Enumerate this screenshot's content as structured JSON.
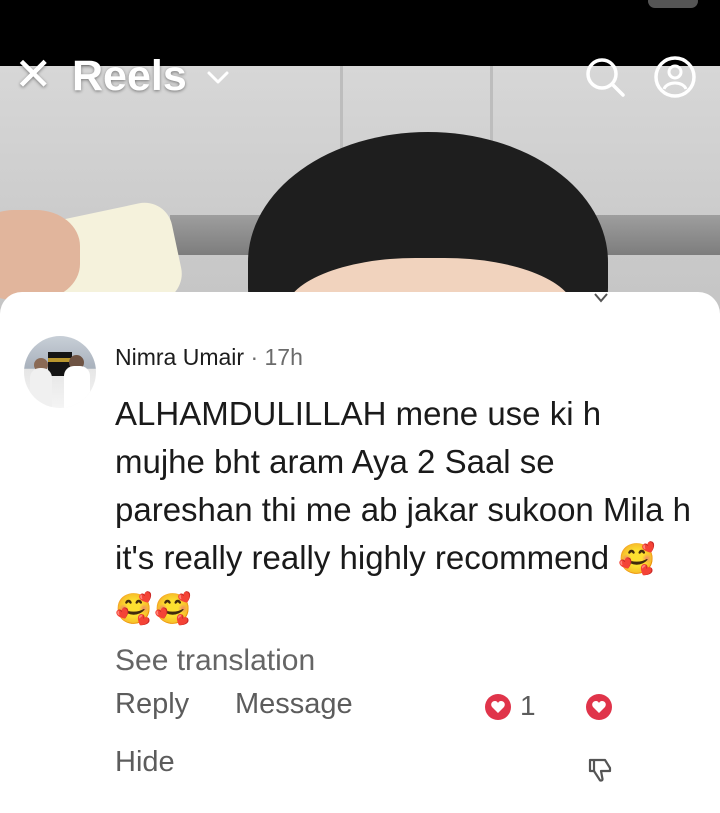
{
  "header": {
    "close_icon": "✕",
    "title": "Reels"
  },
  "comment": {
    "author": "Nimra Umair",
    "separator": "·",
    "time": "17h",
    "text": "ALHAMDULILLAH mene use ki h mujhe bht aram Aya 2 Saal se pareshan thi me ab jakar sukoon Mila h it's really really highly recommend",
    "emojis": "🥰🥰🥰",
    "see_translation": "See translation",
    "actions": {
      "reply": "Reply",
      "message": "Message",
      "hide": "Hide"
    },
    "like_count": "1"
  },
  "colors": {
    "like_red": "#e0344a",
    "text_primary": "#1a1a1a",
    "text_secondary": "#5c5c5c"
  },
  "icons": {
    "close": "close-icon",
    "dropdown": "chevron-down-icon",
    "search": "search-icon",
    "profile": "profile-icon",
    "like": "heart-icon",
    "dislike": "thumbs-down-icon"
  }
}
